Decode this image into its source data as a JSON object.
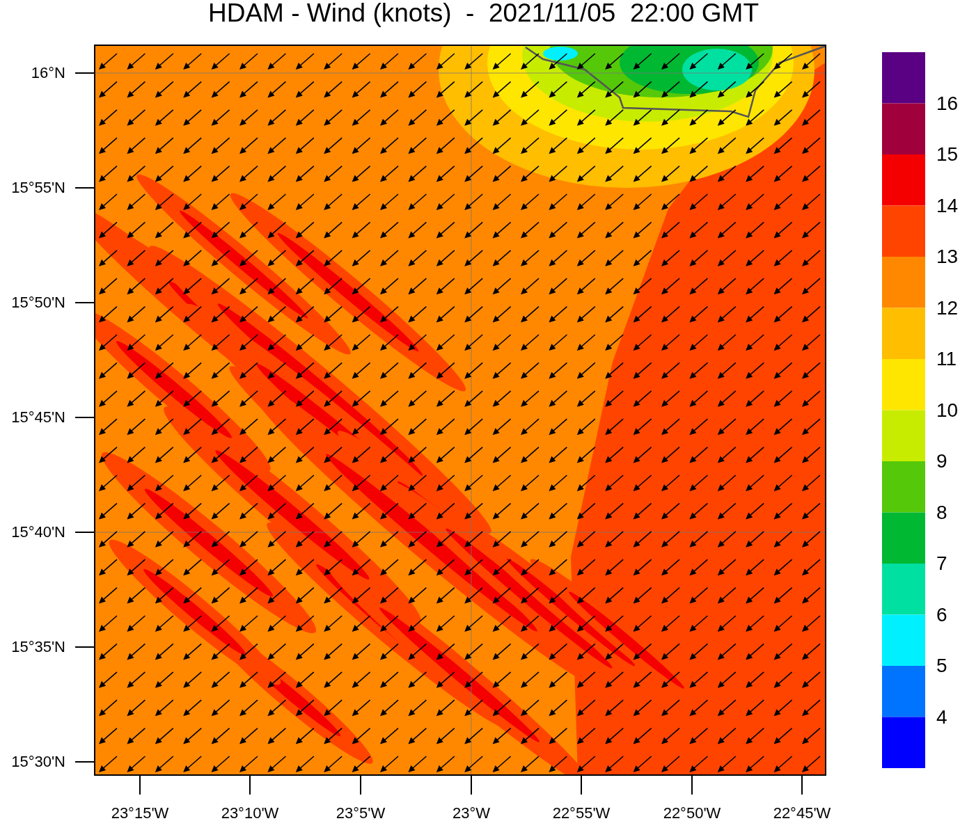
{
  "title": "HDAM - Wind (knots)  -  2021/11/05  22:00 GMT",
  "y_axis": {
    "labels": [
      "16°N",
      "15°55'N",
      "15°50'N",
      "15°45'N",
      "15°40'N",
      "15°35'N",
      "15°30'N"
    ]
  },
  "x_axis": {
    "labels": [
      "23°15'W",
      "23°10'W",
      "23°5'W",
      "23°W",
      "22°55'W",
      "22°50'W",
      "22°45'W"
    ]
  },
  "colorbar": {
    "segments": [
      {
        "color": "#5a0082"
      },
      {
        "color": "#a0003c"
      },
      {
        "color": "#f50000"
      },
      {
        "color": "#ff4400"
      },
      {
        "color": "#ff8800"
      },
      {
        "color": "#ffbe00"
      },
      {
        "color": "#ffe600"
      },
      {
        "color": "#c8ec00"
      },
      {
        "color": "#55c80a"
      },
      {
        "color": "#00b832"
      },
      {
        "color": "#00e0a0"
      },
      {
        "color": "#00f0ff"
      },
      {
        "color": "#0073ff"
      },
      {
        "color": "#0000ff"
      }
    ],
    "labels": [
      "16",
      "15",
      "14",
      "13",
      "12",
      "11",
      "10",
      "9",
      "8",
      "7",
      "6",
      "5",
      "4"
    ]
  }
}
